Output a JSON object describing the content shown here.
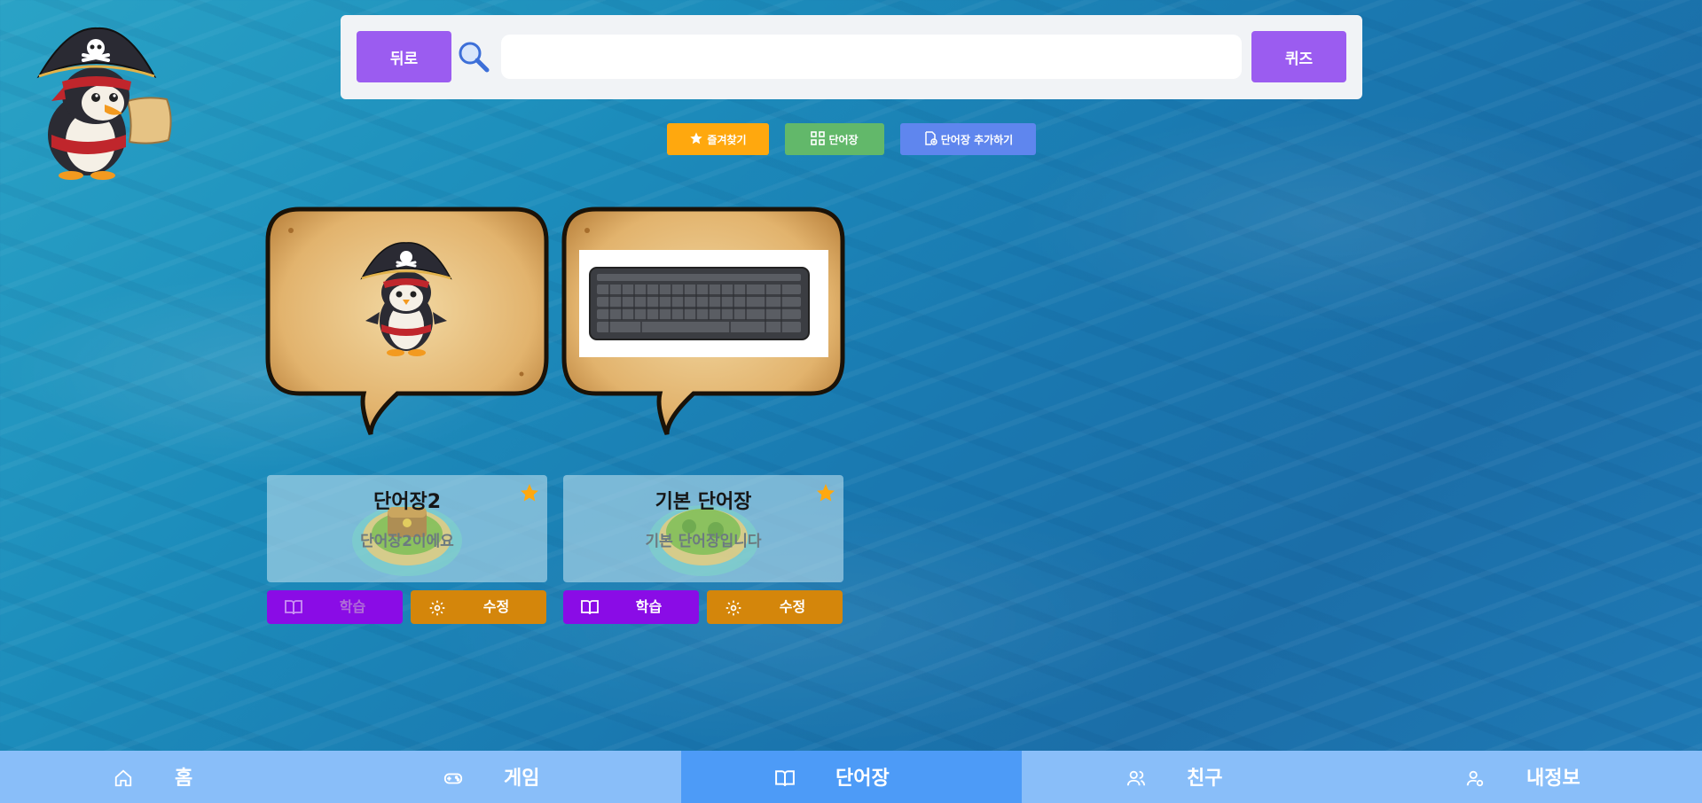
{
  "header": {
    "back_label": "뒤로",
    "quiz_label": "퀴즈",
    "search": {
      "value": "",
      "placeholder": ""
    }
  },
  "filters": {
    "favorites_label": "즐겨찾기",
    "vocab_label": "단어장",
    "add_vocab_label": "단어장 추가하기",
    "colors": {
      "favorites": "#ffa80e",
      "vocab": "#62b86a",
      "add": "#5f86ee"
    }
  },
  "vocab_cards": [
    {
      "title": "단어장2",
      "description": "단어장2이에요",
      "favorite": true,
      "image": "pirate-penguin",
      "learn_label": "학습",
      "edit_label": "수정"
    },
    {
      "title": "기본 단어장",
      "description": "기본 단어장입니다",
      "favorite": true,
      "image": "keyboard",
      "learn_label": "학습",
      "edit_label": "수정"
    }
  ],
  "nav": [
    {
      "label": "홈",
      "icon": "home-icon",
      "active": false
    },
    {
      "label": "게임",
      "icon": "gamepad-icon",
      "active": false
    },
    {
      "label": "단어장",
      "icon": "book-icon",
      "active": true
    },
    {
      "label": "친구",
      "icon": "users-icon",
      "active": false
    },
    {
      "label": "내정보",
      "icon": "user-settings-icon",
      "active": false
    }
  ],
  "colors": {
    "accent_purple": "#9b5cf0",
    "learn_purple": "#8a0ce6",
    "edit_orange": "#d4860b",
    "nav_bg": "#89bef9",
    "nav_active": "#4d9bf7"
  }
}
